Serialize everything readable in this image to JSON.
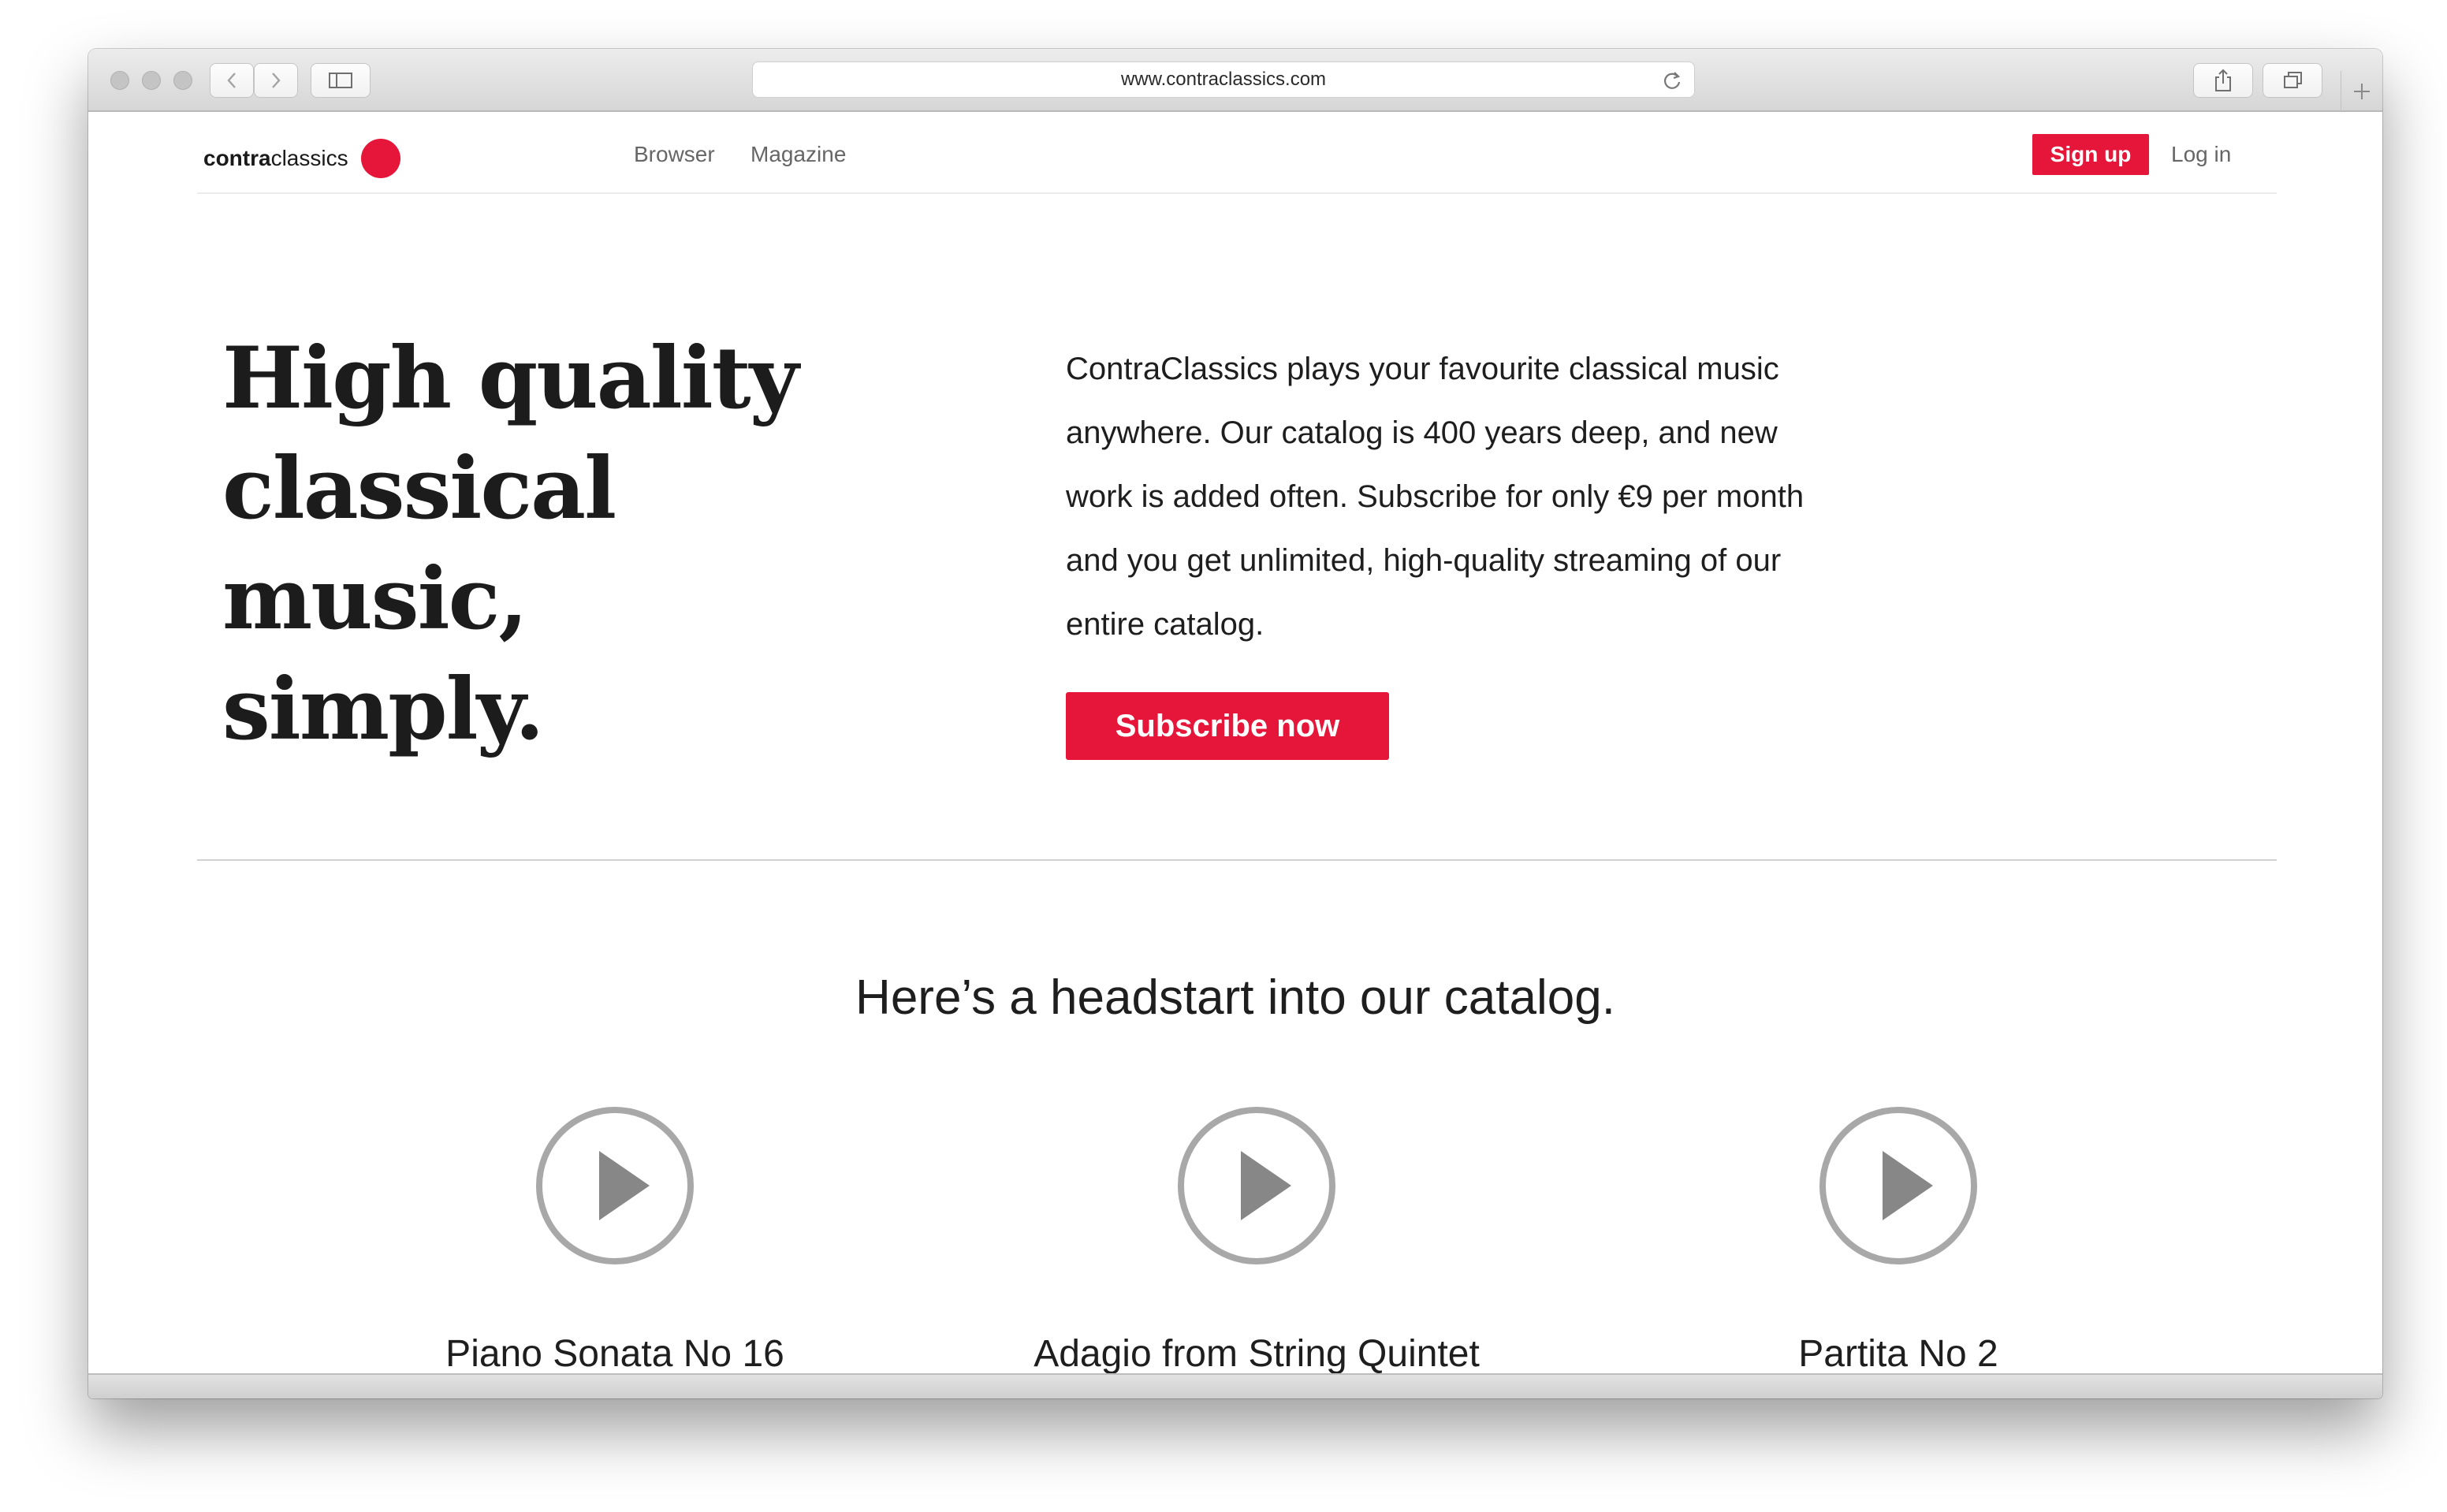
{
  "browser": {
    "url": "www.contraclassics.com"
  },
  "site": {
    "logo_bold": "contra",
    "logo_light": "classics",
    "brand_color": "#e5163a"
  },
  "nav": {
    "items": [
      {
        "label": "Browser"
      },
      {
        "label": "Magazine"
      }
    ],
    "signup_label": "Sign up",
    "login_label": "Log in"
  },
  "hero": {
    "headline_lines": [
      "High quality",
      "classical music,",
      "simply."
    ],
    "intro_lines": [
      "ContraClassics plays your favourite classical music",
      "anywhere. Our catalog is 400 years deep, and new",
      "work is added often. Subscribe for only €9 per month",
      "and you get unlimited, high-quality streaming of our",
      "entire catalog."
    ],
    "cta_label": "Subscribe now"
  },
  "catalog": {
    "title": "Here’s a headstart into our catalog.",
    "tracks": [
      {
        "title": "Piano Sonata No 16",
        "icon": "play-circle-icon"
      },
      {
        "title": "Adagio from String Quintet",
        "icon": "play-circle-icon"
      },
      {
        "title": "Partita No 2",
        "icon": "play-circle-icon"
      }
    ]
  }
}
